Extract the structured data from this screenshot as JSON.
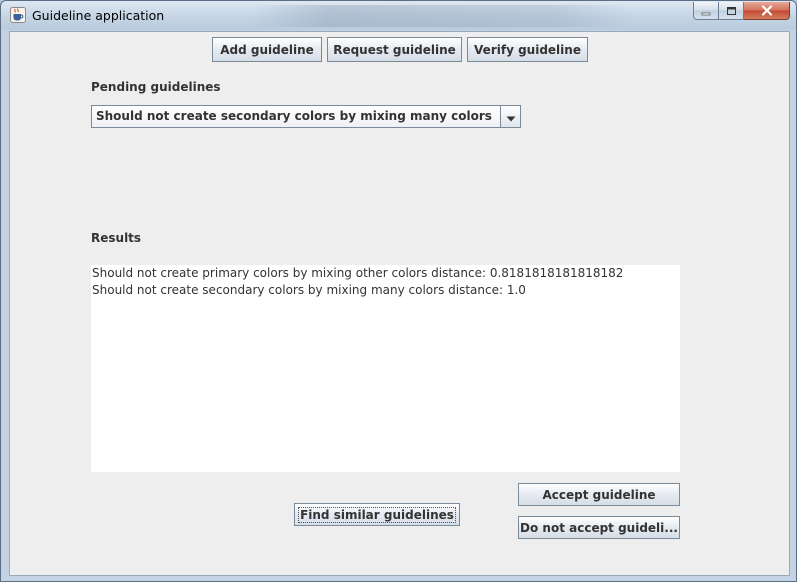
{
  "window": {
    "title": "Guideline application"
  },
  "icons": {
    "app": "java-cup-icon",
    "minimize": "minimize-icon",
    "maximize": "maximize-icon",
    "close": "close-icon",
    "dropdown": "chevron-down-icon"
  },
  "toolbar": {
    "add_label": "Add guideline",
    "request_label": "Request guideline",
    "verify_label": "Verify guideline"
  },
  "pending": {
    "label": "Pending guidelines",
    "selected": "Should not create secondary colors by mixing many colors"
  },
  "results": {
    "label": "Results",
    "lines": [
      "Should not create primary colors by mixing other colors distance: 0.8181818181818182",
      "Should not create secondary colors by mixing many colors distance: 1.0"
    ]
  },
  "actions": {
    "find_similar_label": "Find similar guidelines",
    "accept_label": "Accept guideline",
    "reject_label": "Do not accept guideli..."
  },
  "colors": {
    "client_bg": "#eeeeee",
    "text": "#333333",
    "close_button": "#c24a31"
  }
}
